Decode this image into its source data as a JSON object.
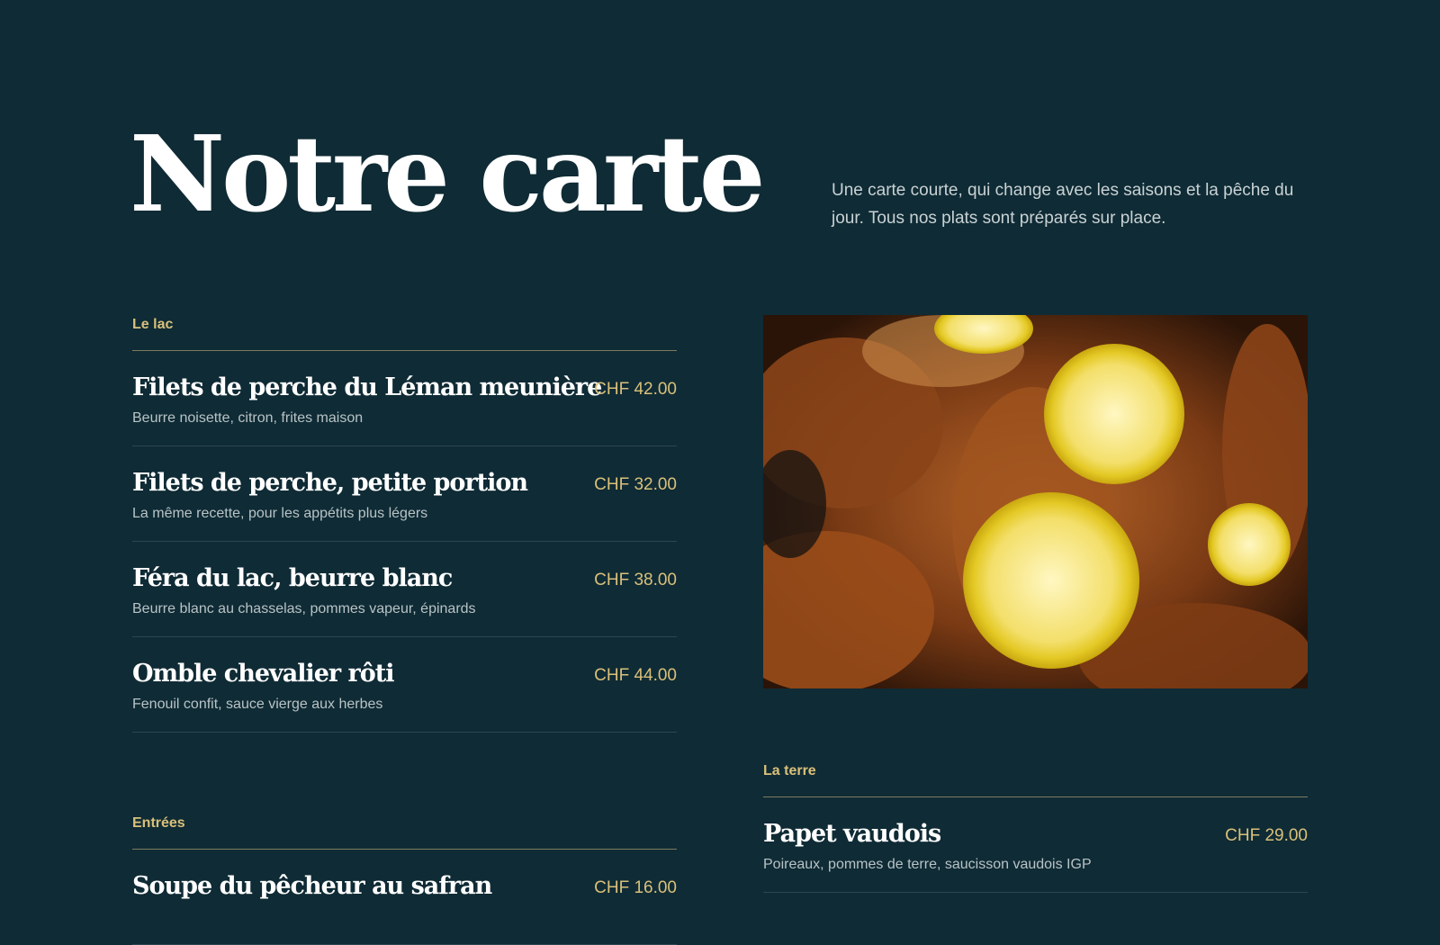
{
  "hero": {
    "title": "Notre carte",
    "intro": "Une carte courte, qui change avec les saisons et la pêche du jour. Tous nos plats sont préparés sur place."
  },
  "sections": [
    {
      "label": "Le lac",
      "items": [
        {
          "name": "Filets de perche du Léman meunière",
          "price": "CHF 42.00",
          "desc": "Beurre noisette, citron, frites maison"
        },
        {
          "name": "Filets de perche, petite portion",
          "price": "CHF 32.00",
          "desc": "La même recette, pour les appétits plus légers"
        },
        {
          "name": "Féra du lac, beurre blanc",
          "price": "CHF 38.00",
          "desc": "Beurre blanc au chasselas, pommes vapeur, épinards"
        },
        {
          "name": "Omble chevalier rôti",
          "price": "CHF 44.00",
          "desc": "Fenouil confit, sauce vierge aux herbes"
        }
      ]
    },
    {
      "label": "Entrées",
      "items": [
        {
          "name": "Soupe du pêcheur au safran",
          "price": "CHF 16.00"
        }
      ]
    },
    {
      "label": "La terre",
      "items": [
        {
          "name": "Papet vaudois",
          "price": "CHF 29.00",
          "desc": "Poireaux, pommes de terre, saucisson vaudois IGP"
        }
      ]
    }
  ],
  "colors": {
    "background": "#0f2b35",
    "accent": "#d9c07a",
    "text": "#ffffff",
    "muted": "#b8c3c6"
  }
}
